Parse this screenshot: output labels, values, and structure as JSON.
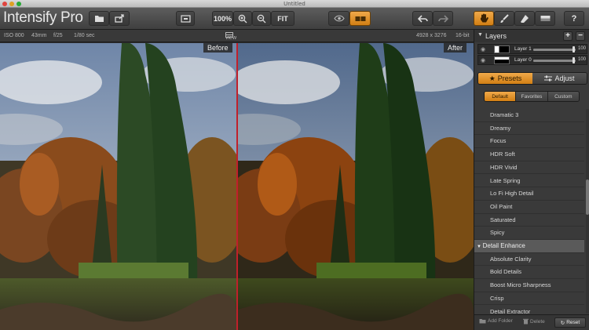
{
  "window": {
    "title": "Untitled"
  },
  "toolbar": {
    "app_name": "Intensify Pro",
    "zoom_100": "100%",
    "fit": "FIT",
    "help": "?"
  },
  "info": {
    "iso": "ISO 800",
    "focal": "43mm",
    "aperture": "f/25",
    "shutter": "1/80 sec",
    "view": "view",
    "dimensions": "4928 x 3276",
    "bitdepth": "16-bit"
  },
  "image_labels": {
    "before": "Before",
    "after": "After"
  },
  "layers": {
    "title": "Layers",
    "items": [
      {
        "name": "Layer 1",
        "opacity": "100",
        "opacity_fraction": 1.0
      },
      {
        "name": "Layer 0",
        "opacity": "100",
        "opacity_fraction": 1.0
      }
    ]
  },
  "panel_tabs": {
    "presets": "Presets",
    "adjust": "Adjust"
  },
  "preset_categories": [
    "Default",
    "Favorites",
    "Custom"
  ],
  "presets_list": [
    {
      "label": "Dramatic 3",
      "group": false
    },
    {
      "label": "Dreamy",
      "group": false
    },
    {
      "label": "Focus",
      "group": false
    },
    {
      "label": "HDR Soft",
      "group": false
    },
    {
      "label": "HDR Vivid",
      "group": false
    },
    {
      "label": "Late Spring",
      "group": false
    },
    {
      "label": "Lo Fi High Detail",
      "group": false
    },
    {
      "label": "Oil Paint",
      "group": false
    },
    {
      "label": "Saturated",
      "group": false
    },
    {
      "label": "Spicy",
      "group": false
    },
    {
      "label": "Detail Enhance",
      "group": true
    },
    {
      "label": "Absolute Clarity",
      "group": false
    },
    {
      "label": "Bold Details",
      "group": false
    },
    {
      "label": "Boost Micro Sharpness",
      "group": false
    },
    {
      "label": "Crisp",
      "group": false
    },
    {
      "label": "Detail Extractor",
      "group": false
    }
  ],
  "footer": {
    "add_folder": "Add Folder",
    "delete": "Delete",
    "reset": "Reset"
  },
  "colors": {
    "accent": "#e39330",
    "divider": "#c0202b"
  }
}
